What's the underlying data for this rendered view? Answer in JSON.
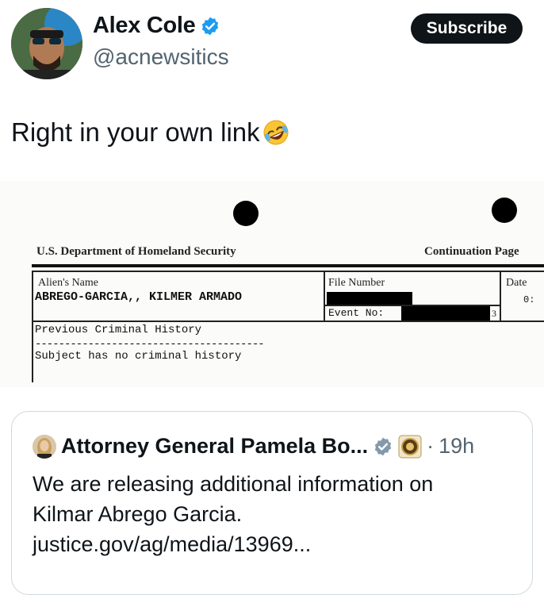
{
  "author": {
    "name": "Alex Cole",
    "handle": "@acnewsitics",
    "verified_icon": "verified-badge-icon",
    "subscribe_label": "Subscribe"
  },
  "tweet": {
    "text": "Right in your own link",
    "emoji_icon": "rolling-on-floor-laughing-emoji"
  },
  "document": {
    "agency": "U.S. Department of Homeland Security",
    "page_type": "Continuation Page",
    "alien_name_label": "Alien's Name",
    "alien_name_value": "ABREGO-GARCIA,, KILMER ARMADO",
    "file_number_label": "File Number",
    "event_no_label": "Event No:",
    "event_trailing": "3",
    "date_label": "Date",
    "date_value_partial": "0:",
    "history_heading": "Previous Criminal History",
    "history_divider": "---------------------------------------",
    "history_text": "Subject has no criminal history"
  },
  "quoted_tweet": {
    "name": "Attorney General Pamela Bo...",
    "separator": "·",
    "time": "19h",
    "line1": "We are releasing additional information on",
    "line2": "Kilmar Abrego Garcia.",
    "line3": "justice.gov/ag/media/13969...",
    "affiliation_icon": "doj-seal-icon",
    "verified_icon": "gray-verified-badge-icon"
  },
  "colors": {
    "text": "#0f1419",
    "muted": "#536471",
    "verified_blue": "#1d9bf0",
    "verified_gray": "#829aab",
    "border": "#cfd9de"
  }
}
